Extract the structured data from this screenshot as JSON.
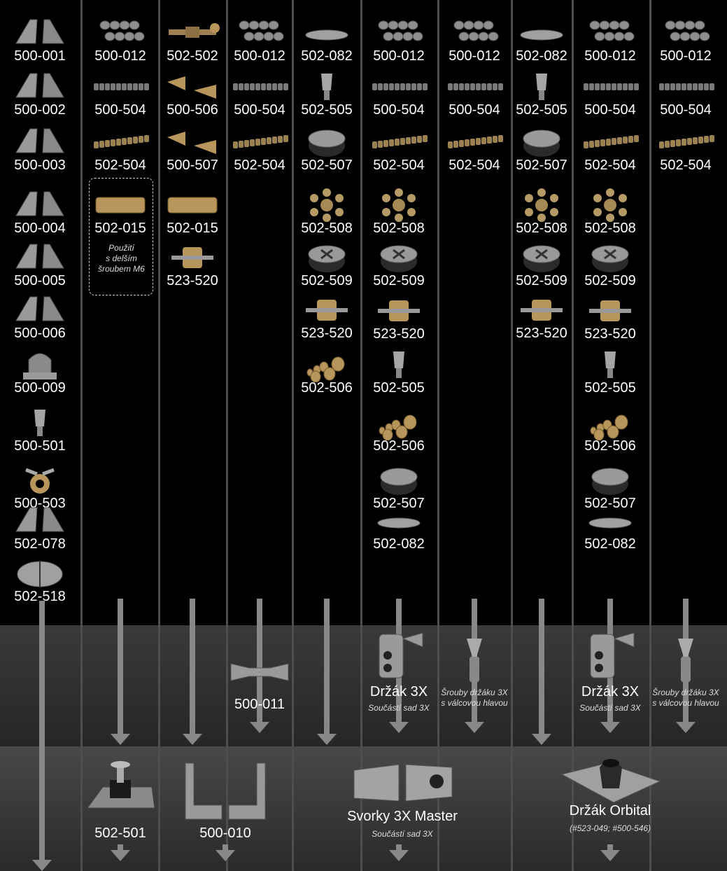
{
  "note": [
    "Použití",
    "s delším",
    "šroubem M6"
  ],
  "columns": [
    {
      "parts": [
        "500-001",
        "500-002",
        "500-003",
        "500-004",
        "500-005",
        "500-006",
        "500-009",
        "500-501",
        "500-503",
        "502-078",
        "502-518"
      ]
    },
    {
      "parts": [
        "500-012",
        "500-504",
        "502-504",
        "502-015"
      ]
    },
    {
      "parts": [
        "502-502",
        "500-506",
        "500-507",
        "502-015",
        "523-520"
      ]
    },
    {
      "parts": [
        "500-012",
        "500-504",
        "502-504"
      ]
    },
    {
      "parts": [
        "502-082",
        "502-505",
        "502-507",
        "502-508",
        "502-509",
        "523-520",
        "502-506"
      ]
    },
    {
      "parts": [
        "500-012",
        "500-504",
        "502-504",
        "502-508",
        "502-509",
        "523-520",
        "502-505",
        "502-506",
        "502-507",
        "502-082"
      ]
    },
    {
      "parts": [
        "500-012",
        "500-504",
        "502-504"
      ]
    },
    {
      "parts": [
        "502-082",
        "502-505",
        "502-507",
        "502-508",
        "502-509",
        "523-520"
      ]
    },
    {
      "parts": [
        "500-012",
        "500-504",
        "502-504",
        "502-508",
        "502-509",
        "523-520",
        "502-505",
        "502-506",
        "502-507",
        "502-082"
      ]
    },
    {
      "parts": [
        "500-012",
        "500-504",
        "502-504"
      ]
    }
  ],
  "intermediate": [
    {
      "title": "500-011",
      "subtitle": "",
      "icon": "bone-connector-icon"
    },
    {
      "title": "Držák 3X",
      "subtitle": "Součástí sad 3X",
      "icon": "holder-3x-icon"
    },
    {
      "title": "",
      "subtitle": "Šrouby držáku 3X s válcovou hlavou",
      "icon": "screw-icon"
    },
    {
      "title": "Držák 3X",
      "subtitle": "Součástí sad 3X",
      "icon": "holder-3x-icon"
    },
    {
      "title": "",
      "subtitle": "Šrouby držáku 3X s válcovou hlavou",
      "icon": "screw-icon"
    }
  ],
  "products": [
    {
      "title": "502-501",
      "subtitle": "",
      "icon": "clamp-icon"
    },
    {
      "title": "500-010",
      "subtitle": "",
      "icon": "angle-bracket-icon"
    },
    {
      "title": "Svorky 3X Master",
      "subtitle": "Součástí sad 3X",
      "icon": "master-clamp-icon"
    },
    {
      "title": "Držák Orbital",
      "subtitle": "(#523-049; #500-546)",
      "icon": "orbital-holder-icon"
    }
  ],
  "colors": {
    "background": "#000000",
    "arrow": "#888888",
    "separator": "#4e4e4e",
    "metal": "#9a9a9a",
    "brass": "#b8955a"
  }
}
